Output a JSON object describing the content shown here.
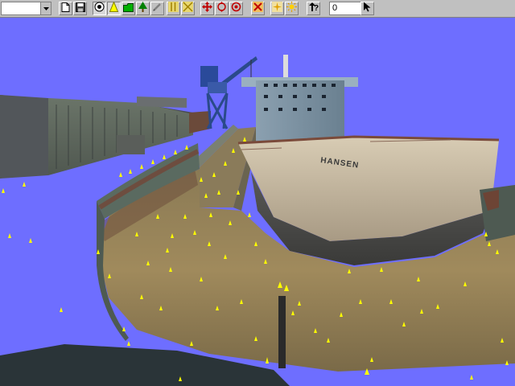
{
  "toolbar": {
    "combo_value": "",
    "number_field_value": "0",
    "buttons": [
      {
        "icon": "new-document-icon"
      },
      {
        "icon": "save-icon"
      },
      {
        "icon": "eye-view-icon"
      },
      {
        "icon": "yellow-cone-icon"
      },
      {
        "icon": "green-folder-icon"
      },
      {
        "icon": "green-tree-icon"
      },
      {
        "icon": "pencil-icon"
      },
      {
        "icon": "vertical-guides-icon"
      },
      {
        "icon": "cross-guide-icon"
      },
      {
        "icon": "move-arrows-icon"
      },
      {
        "icon": "rotate-arrows-icon"
      },
      {
        "icon": "target-icon"
      },
      {
        "icon": "delete-x-icon"
      },
      {
        "icon": "sparkle-icon"
      },
      {
        "icon": "light-icon"
      },
      {
        "icon": "help-icon"
      },
      {
        "icon": "cursor-arrow-icon"
      }
    ]
  },
  "scene": {
    "ship_name": "HANSEN",
    "sky_color": "#6e6eff",
    "marker_color": "#ffff00"
  }
}
